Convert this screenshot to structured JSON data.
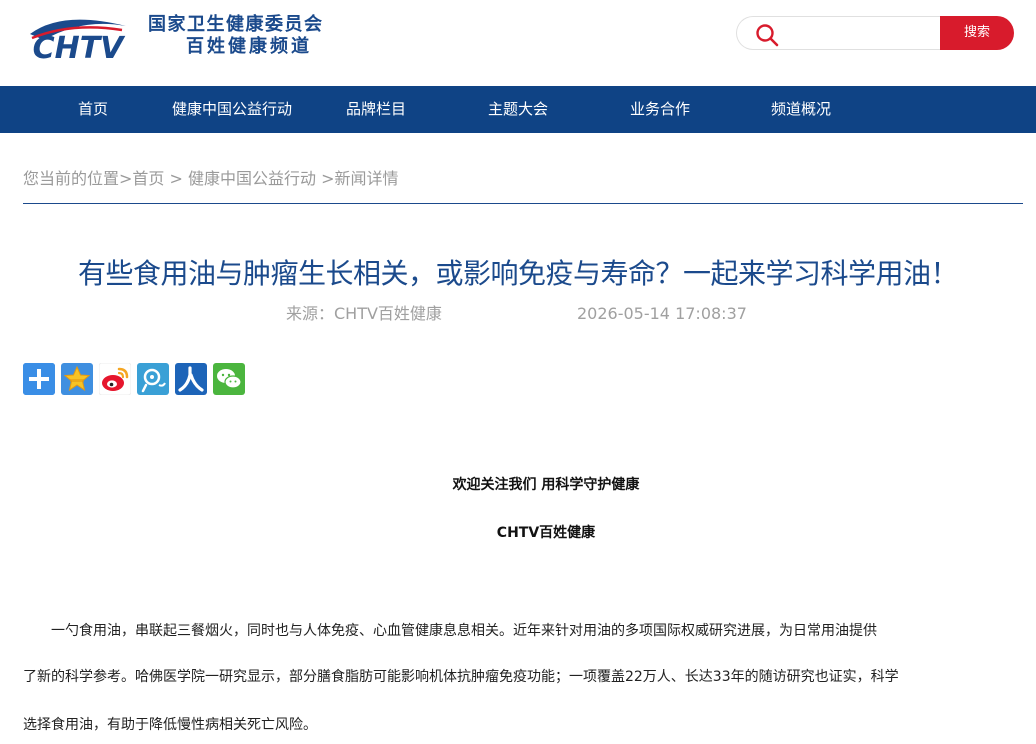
{
  "header": {
    "logo_text": "CHTV",
    "org_name": "国家卫生健康委员会",
    "channel_name": "百姓健康频道",
    "search": {
      "placeholder": "",
      "button_label": "搜索"
    }
  },
  "nav": {
    "items": [
      {
        "label": "首页"
      },
      {
        "label": "健康中国公益行动"
      },
      {
        "label": "品牌栏目"
      },
      {
        "label": "主题大会"
      },
      {
        "label": "业务合作"
      },
      {
        "label": "频道概况"
      }
    ]
  },
  "breadcrumb": {
    "text": "您当前的位置>首页 > 健康中国公益行动 >新闻详情"
  },
  "article": {
    "title": "有些食用油与肿瘤生长相关，或影响免疫与寿命？一起来学习科学用油！",
    "source": "来源：CHTV百姓健康",
    "date": "2026-05-14 17:08:37",
    "share_icons": [
      {
        "name": "share-more-icon"
      },
      {
        "name": "qzone-icon"
      },
      {
        "name": "weibo-icon"
      },
      {
        "name": "tencent-weibo-icon"
      },
      {
        "name": "renren-icon"
      },
      {
        "name": "wechat-icon"
      }
    ],
    "slogan": "欢迎关注我们 用科学守护健康",
    "brand": "CHTV百姓健康",
    "paragraph_lines": [
      "　　一勺食用油，串联起三餐烟火，同时也与人体免疫、心血管健康息息相关。近年来针对用油的多项国际权威研究进展，为日常用油提供",
      "了新的科学参考。哈佛医学院一研究显示，部分膳食脂肪可能影响机体抗肿瘤免疫功能；一项覆盖22万人、长达33年的随访研究也证实，科学",
      "选择食用油，有助于降低慢性病相关死亡风险。"
    ]
  },
  "colors": {
    "brand_blue": "#1b4a8c",
    "nav_blue": "#0f4385",
    "accent_red": "#d81b2c"
  }
}
